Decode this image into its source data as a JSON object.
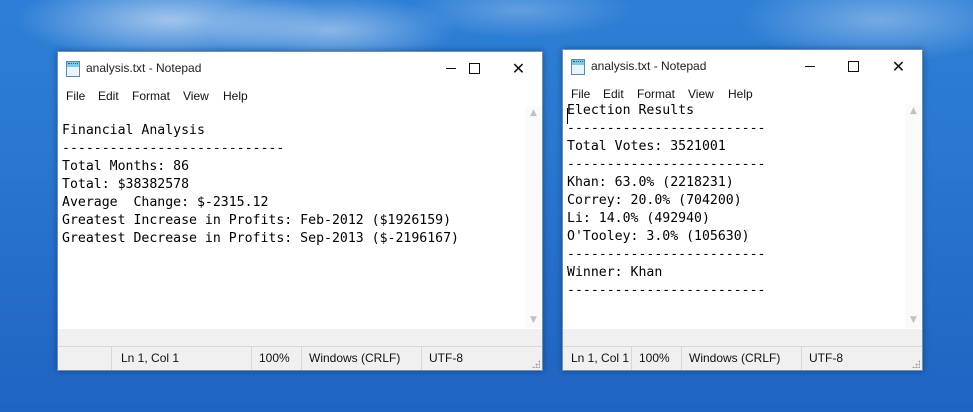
{
  "windows": [
    {
      "title": "analysis.txt - Notepad",
      "menu": [
        "File",
        "Edit",
        "Format",
        "View",
        "Help"
      ],
      "lines": [
        "",
        "Financial Analysis",
        "----------------------------",
        "Total Months: 86",
        "Total: $38382578",
        "Average  Change: $-2315.12",
        "Greatest Increase in Profits: Feb-2012 ($1926159)",
        "Greatest Decrease in Profits: Sep-2013 ($-2196167)"
      ],
      "status": {
        "position": "Ln 1, Col 1",
        "zoom": "100%",
        "line_ending": "Windows (CRLF)",
        "encoding": "UTF-8"
      }
    },
    {
      "title": "analysis.txt - Notepad",
      "menu": [
        "File",
        "Edit",
        "Format",
        "View",
        "Help"
      ],
      "lines": [
        "Election Results",
        "-------------------------",
        "Total Votes: 3521001",
        "-------------------------",
        "Khan: 63.0% (2218231)",
        "Correy: 20.0% (704200)",
        "Li: 14.0% (492940)",
        "O'Tooley: 3.0% (105630)",
        "-------------------------",
        "Winner: Khan",
        "-------------------------"
      ],
      "status": {
        "position": "Ln 1, Col 1",
        "zoom": "100%",
        "line_ending": "Windows (CRLF)",
        "encoding": "UTF-8"
      }
    }
  ],
  "icons": {
    "app": "notepad-icon",
    "minimize": "minimize-icon",
    "maximize": "maximize-icon",
    "close": "close-icon",
    "close_glyph": "✕"
  }
}
